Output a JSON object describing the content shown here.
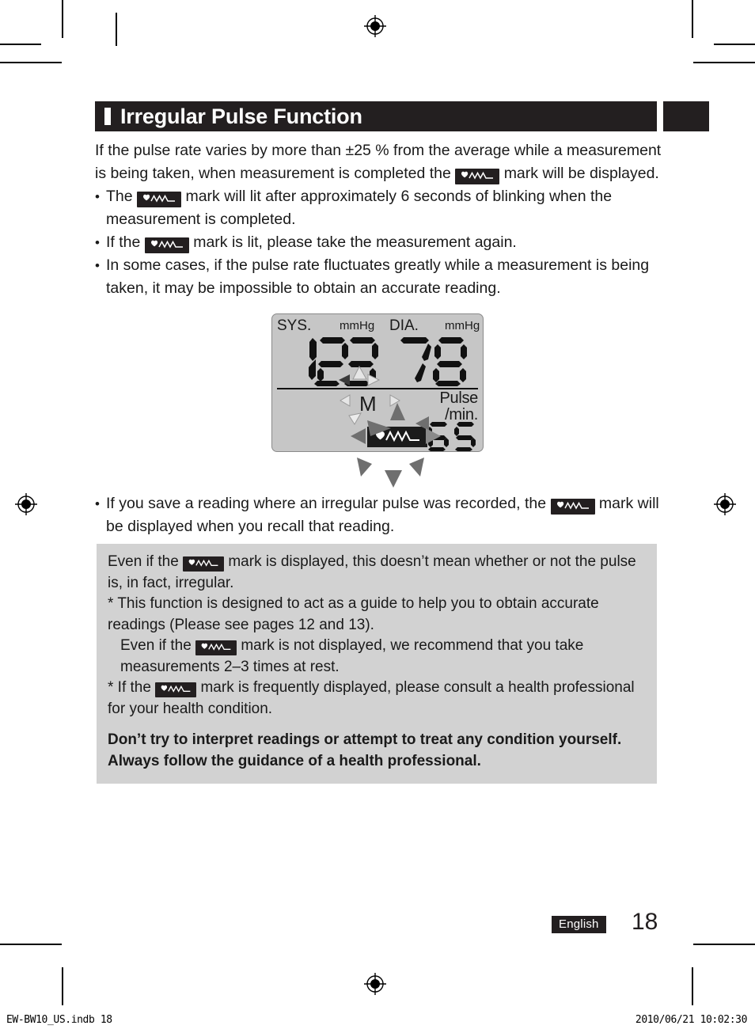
{
  "header": {
    "title": "Irregular Pulse Function",
    "accent_color": "#231f20"
  },
  "icons": {
    "irregular_pulse_mark": "irregular-pulse-mark-icon"
  },
  "intro": {
    "part1": "If the pulse rate varies by more than ±25 % from the average while a measurement is being taken, when measurement is completed the",
    "part2": "mark will be displayed."
  },
  "bullets": [
    {
      "marker": "•",
      "part1": "The",
      "part2": "mark will lit after approximately 6 seconds of blinking when the measurement is completed."
    },
    {
      "marker": "•",
      "part1": "If the",
      "part2": "mark is lit, please take the measurement again."
    },
    {
      "marker": "•",
      "part1": "In some cases, if the pulse rate fluctuates greatly while a measurement is being taken, it may be impossible to obtain an accurate reading.",
      "part2": ""
    }
  ],
  "lcd": {
    "sys_label": "SYS.",
    "sys_unit": "mmHg",
    "sys_value": "123",
    "dia_label": "DIA.",
    "dia_unit": "mmHg",
    "dia_value": "78",
    "memory_marker": "M",
    "pulse_label": "Pulse",
    "pulse_unit": "/min.",
    "pulse_value": "65",
    "background_color": "#c6c6c6",
    "badge_color": "#1b1b1b"
  },
  "post_lcd_bullet": {
    "marker": "•",
    "part1": "If you save a reading where an irregular pulse was recorded, the",
    "part2": "mark will be displayed when you recall that reading."
  },
  "notebox": {
    "background_color": "#d2d2d2",
    "line1_part1": "Even if the",
    "line1_part2": "mark is displayed, this doesn’t mean whether or not the pulse is, in fact, irregular.",
    "line2_part1": "* This function is designed to act as a guide to help you to obtain accurate readings (Please see pages 12 and 13).",
    "line3_part1": "Even if the",
    "line3_part2": "mark is not displayed, we recommend that you take measurements 2–3 times at rest.",
    "line4_part1": "* If the",
    "line4_part2": "mark is frequently displayed, please consult a health professional for your health condition.",
    "bold1": "Don’t try to interpret readings or attempt to treat any condition yourself.",
    "bold2": "Always follow the guidance of a health professional."
  },
  "footer": {
    "language_badge": "English",
    "page_number": "18",
    "print_file": "EW-BW10_US.indb   18",
    "print_timestamp": "2010/06/21   10:02:30"
  }
}
